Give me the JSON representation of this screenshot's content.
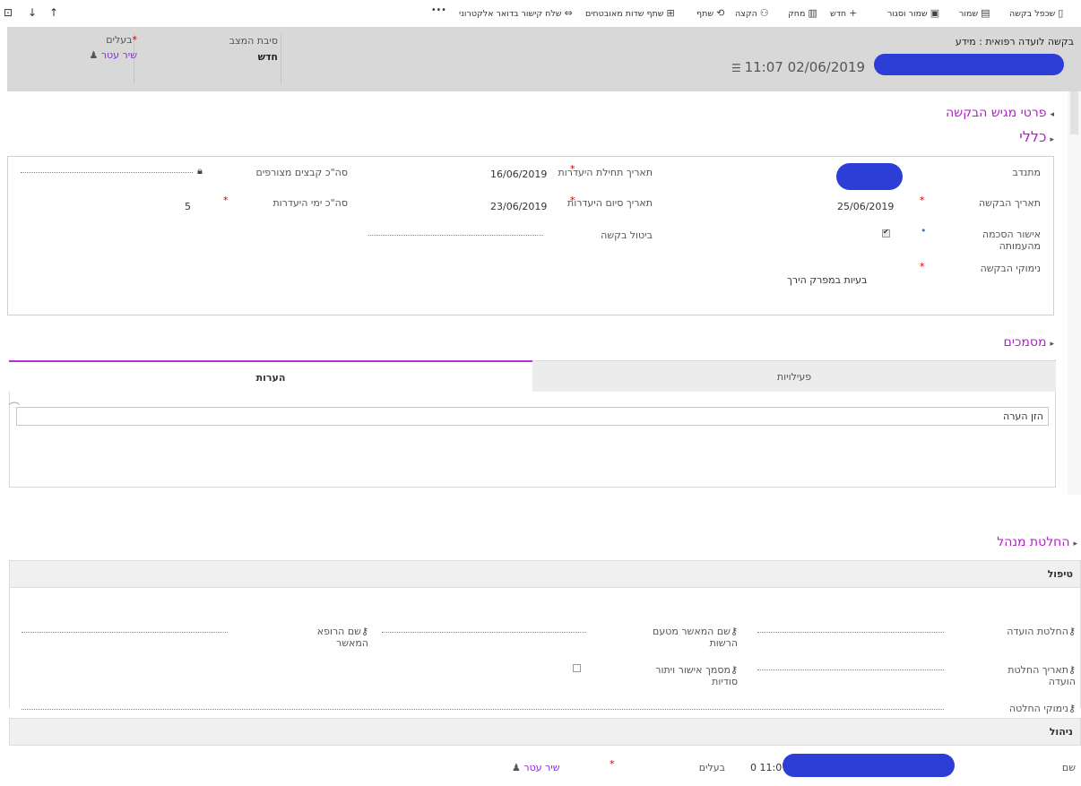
{
  "toolbar": {
    "items": [
      {
        "label": "שכפל בקשה",
        "icon": "copy-icon"
      },
      {
        "label": "שמור",
        "icon": "save-icon"
      },
      {
        "label": "שמור וסגור",
        "icon": "save-close-icon"
      },
      {
        "label": "חדש",
        "icon": "plus-icon"
      },
      {
        "label": "מחק",
        "icon": "trash-icon"
      },
      {
        "label": "הקצה",
        "icon": "assign-icon"
      },
      {
        "label": "שתף",
        "icon": "share-icon"
      },
      {
        "label": "שתף שדות מאובטחים",
        "icon": "share-secure-icon"
      },
      {
        "label": "שלח קישור בדואר אלקטרוני",
        "icon": "link-icon"
      }
    ],
    "more": "•••"
  },
  "header": {
    "entity_title": "בקשה לועדה רפואית : מידע",
    "record_datetime": "11:07 02/06/2019",
    "status_reason_label": "סיבת המצב",
    "status_reason_value": "חדש",
    "owner_label": "בעלים",
    "owner_required": "*",
    "owner_value": "שיר עטר"
  },
  "sections": {
    "requester": "פרטי מגיש הבקשה",
    "general": "כללי",
    "documents": "מסמכים",
    "manager_decision": "החלטת מנהל"
  },
  "general": {
    "volunteer_label": "מתנדב",
    "request_date_label": "תאריך הבקשה",
    "request_date_value": "25/06/2019",
    "org_approval_label": "אישור הסכמה מהעמותה",
    "org_approval_checked": true,
    "request_reasons_label": "נימוקי הבקשה",
    "request_reasons_value": "בעיות במפרק הירך",
    "absence_start_label": "תאריך תחילת היעדרות",
    "absence_start_value": "16/06/2019",
    "absence_end_label": "תאריך סיום היעדרות",
    "absence_end_value": "23/06/2019",
    "cancel_request_label": "ביטול בקשה",
    "attached_files_label": "סה\"כ קבצים מצורפים",
    "absence_days_label": "סה\"כ ימי היעדרות",
    "absence_days_value": "5"
  },
  "documents": {
    "tabs": [
      "פעילויות",
      "הערות"
    ],
    "note_placeholder": "הזן הערה"
  },
  "handling": {
    "title": "טיפול",
    "committee_decision_label": "החלטת הועדה",
    "approver_name_label": "שם המאשר מטעם הרשות",
    "approving_doctor_label": "שם הרופא המאשר",
    "decision_date_label": "תאריך החלטת הועדה",
    "confidentiality_doc_label": "מסמך אישור ויתור סודיות",
    "decision_reasons_label": "נימוקי החלטה"
  },
  "admin": {
    "title": "ניהול",
    "name_label": "שם",
    "name_value_prefix": "11:07 0",
    "owner_label": "בעלים",
    "owner_value": "שיר עטר"
  }
}
